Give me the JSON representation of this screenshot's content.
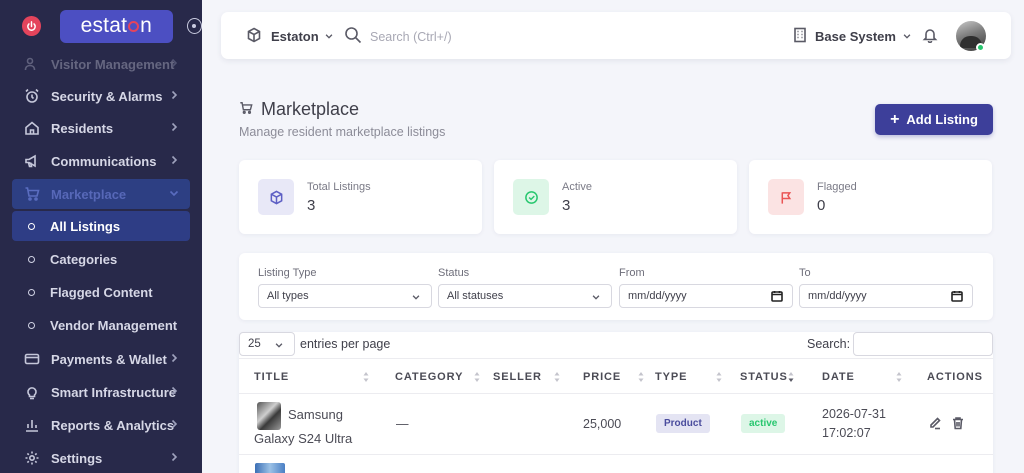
{
  "brand": {
    "logo_text_left": "estat",
    "logo_text_right": "n"
  },
  "sidebar": {
    "items": [
      {
        "label": "Visitor Management",
        "icon": "users-icon"
      },
      {
        "label": "Security & Alarms",
        "icon": "alarm-icon"
      },
      {
        "label": "Residents",
        "icon": "home-icon"
      },
      {
        "label": "Communications",
        "icon": "megaphone-icon"
      },
      {
        "label": "Marketplace",
        "icon": "cart-icon"
      },
      {
        "label": "Payments & Wallet",
        "icon": "card-icon"
      },
      {
        "label": "Smart Infrastructure",
        "icon": "bulb-icon"
      },
      {
        "label": "Reports & Analytics",
        "icon": "chart-icon"
      },
      {
        "label": "Settings",
        "icon": "gear-icon"
      }
    ],
    "sub_items": [
      {
        "label": "All Listings",
        "active": true
      },
      {
        "label": "Categories"
      },
      {
        "label": "Flagged Content"
      },
      {
        "label": "Vendor Management"
      }
    ]
  },
  "topbar": {
    "estate_name": "Estaton",
    "search_placeholder": "Search (Ctrl+/)",
    "system_name": "Base System"
  },
  "page": {
    "title": "Marketplace",
    "subtitle": "Manage resident marketplace listings",
    "add_button": "Add Listing"
  },
  "stats": [
    {
      "label": "Total Listings",
      "value": "3",
      "color": "#5d5fc4",
      "bg": "#e8e8f7"
    },
    {
      "label": "Active",
      "value": "3",
      "color": "#28c76f",
      "bg": "#ddf6e7"
    },
    {
      "label": "Flagged",
      "value": "0",
      "color": "#ea5455",
      "bg": "#fbe3e3"
    }
  ],
  "filters": {
    "type_label": "Listing Type",
    "type_value": "All types",
    "status_label": "Status",
    "status_value": "All statuses",
    "from_label": "From",
    "from_placeholder": "mm/dd/yyyy",
    "to_label": "To",
    "to_placeholder": "mm/dd/yyyy"
  },
  "table": {
    "page_length": "25",
    "entries_label": "entries per page",
    "search_label": "Search:",
    "columns": [
      "TITLE",
      "CATEGORY",
      "SELLER",
      "PRICE",
      "TYPE",
      "STATUS",
      "DATE",
      "ACTIONS"
    ],
    "rows": [
      {
        "title_line1": "Samsung",
        "title_line2": "Galaxy S24 Ultra",
        "category": "—",
        "seller": "",
        "price": "25,000",
        "type": "Product",
        "status": "active",
        "date_line1": "2026-07-31",
        "date_line2": "17:02:07"
      }
    ]
  },
  "colors": {
    "sidebar_bg": "#28294a",
    "primary": "#3d3f9a",
    "success": "#28c76f",
    "danger": "#ea5455"
  }
}
